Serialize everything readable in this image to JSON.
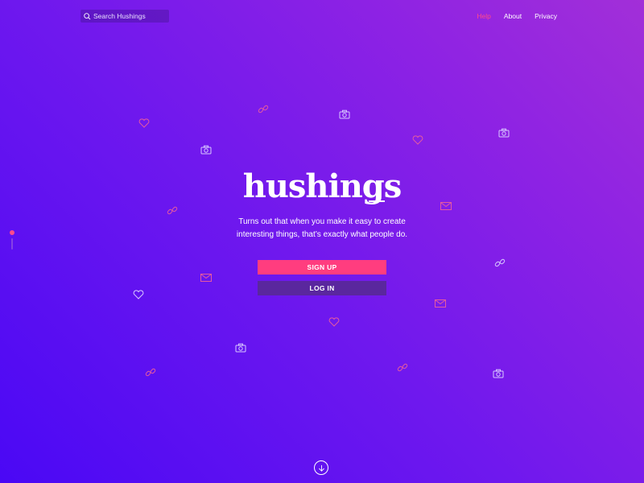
{
  "search": {
    "placeholder": "Search Hushings"
  },
  "nav": {
    "items": [
      {
        "label": "Help"
      },
      {
        "label": "About"
      },
      {
        "label": "Privacy"
      }
    ]
  },
  "hero": {
    "logo": "hushings",
    "tagline_line1": "Turns out that when you make it easy to create",
    "tagline_line2": "interesting things, that’s exactly what people do."
  },
  "actions": {
    "signup_label": "SIGN UP",
    "login_label": "LOG IN"
  },
  "colors": {
    "accent": "#ff3d7f",
    "login_bg": "#5a279e",
    "bg_start": "#4a08f5",
    "bg_end": "#a22fd8"
  },
  "icons": [
    "search-icon",
    "arrow-down-icon",
    "heart-icon",
    "camera-icon",
    "link-icon",
    "mail-icon"
  ]
}
